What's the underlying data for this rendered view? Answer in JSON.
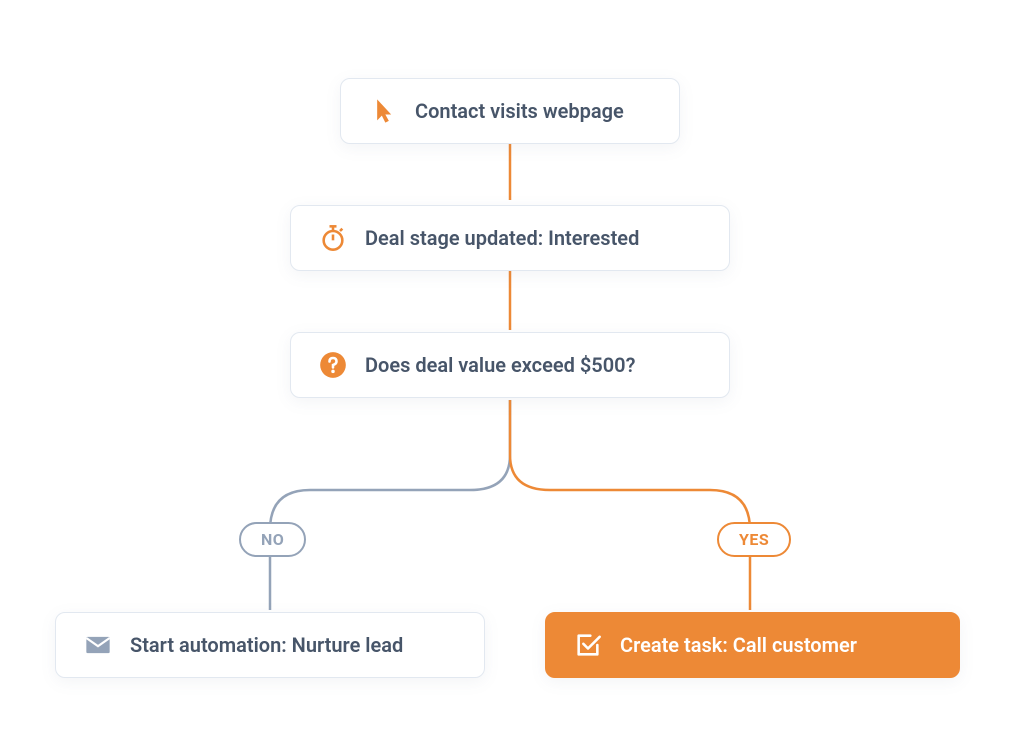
{
  "colors": {
    "accent": "#ed8936",
    "gray": "#94a3b8",
    "text": "#475569"
  },
  "nodes": {
    "n1": {
      "label": "Contact visits webpage",
      "icon": "cursor-icon"
    },
    "n2": {
      "label": "Deal stage updated: Interested",
      "icon": "stopwatch-icon"
    },
    "n3": {
      "label": "Does deal value exceed $500?",
      "icon": "question-icon"
    },
    "n4": {
      "label": "Start automation: Nurture lead",
      "icon": "mail-icon"
    },
    "n5": {
      "label": "Create task: Call customer",
      "icon": "checkbox-icon"
    }
  },
  "branches": {
    "no": "NO",
    "yes": "YES"
  }
}
